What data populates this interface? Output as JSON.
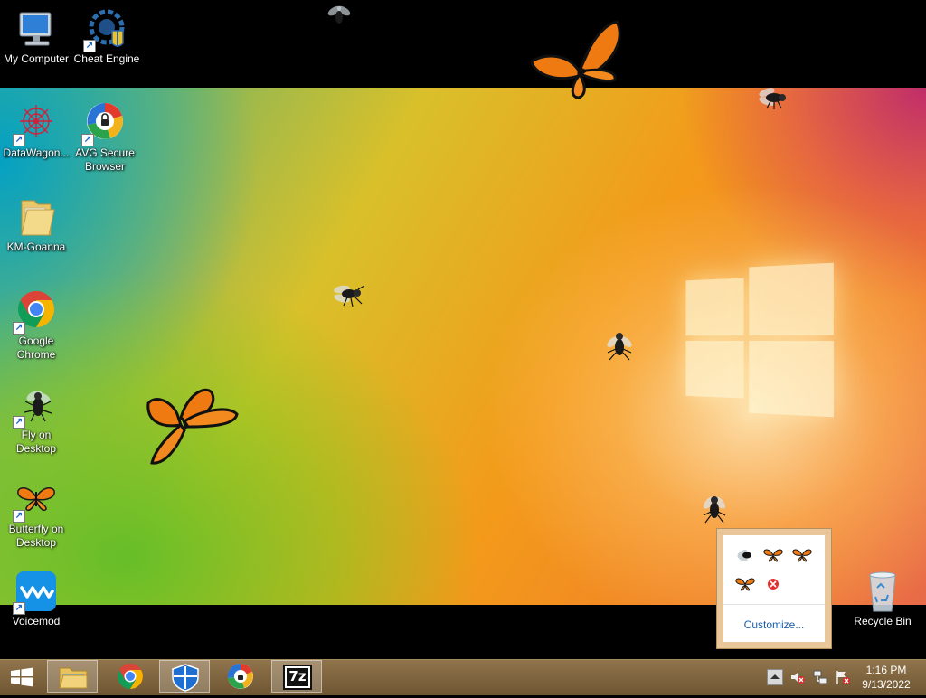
{
  "desktop": {
    "icons": [
      {
        "label": "My Computer"
      },
      {
        "label": "Cheat Engine"
      },
      {
        "label": "DataWagon..."
      },
      {
        "label": "AVG Secure Browser"
      },
      {
        "label": "KM-Goanna"
      },
      {
        "label": "Google Chrome"
      },
      {
        "label": "Fly on Desktop"
      },
      {
        "label": "Butterfly on Desktop"
      },
      {
        "label": "Voicemod"
      },
      {
        "label": "Recycle Bin"
      }
    ]
  },
  "taskbar": {
    "start_icon": "windows-logo",
    "pinned": [
      {
        "name": "file-explorer",
        "active": true
      },
      {
        "name": "google-chrome",
        "active": false
      },
      {
        "name": "security-shield",
        "active": true
      },
      {
        "name": "avg-secure-browser",
        "active": false
      },
      {
        "name": "7-zip",
        "label": "7z",
        "active": true
      }
    ],
    "tray_icons": [
      "show-hidden-icons",
      "volume-muted",
      "network",
      "action-center-alert"
    ],
    "clock": {
      "time": "1:16 PM",
      "date": "9/13/2022"
    }
  },
  "tray_popup": {
    "items": [
      "fly-icon",
      "butterfly-icon",
      "butterfly-icon",
      "butterfly-icon",
      "error-icon"
    ],
    "customize_label": "Customize..."
  },
  "colors": {
    "taskbar": "#7f6540",
    "popup_border": "#e9c79a",
    "link": "#1c5fa8"
  }
}
